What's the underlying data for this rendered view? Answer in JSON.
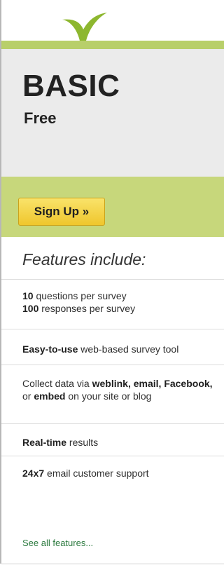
{
  "logo": {
    "icon": "leaf-icon",
    "color": "#8db72f"
  },
  "plan": {
    "name": "BASIC",
    "price": "Free"
  },
  "cta": {
    "label": "Sign Up »"
  },
  "features": {
    "title": "Features include:",
    "items": [
      {
        "strong": "10",
        "text": " questions per survey"
      },
      {
        "strong": "100",
        "text": " responses per survey"
      },
      {
        "strong": "Easy-to-use",
        "text": " web-based survey tool"
      },
      {
        "pre": "Collect data via ",
        "strong1": "weblink, email, Facebook,",
        "mid": " or ",
        "strong2": "embed",
        "post": " on your site or blog"
      },
      {
        "strong": "Real-time",
        "text": " results"
      },
      {
        "strong": "24x7",
        "text": " email customer support"
      }
    ],
    "see_all": "See all features..."
  }
}
